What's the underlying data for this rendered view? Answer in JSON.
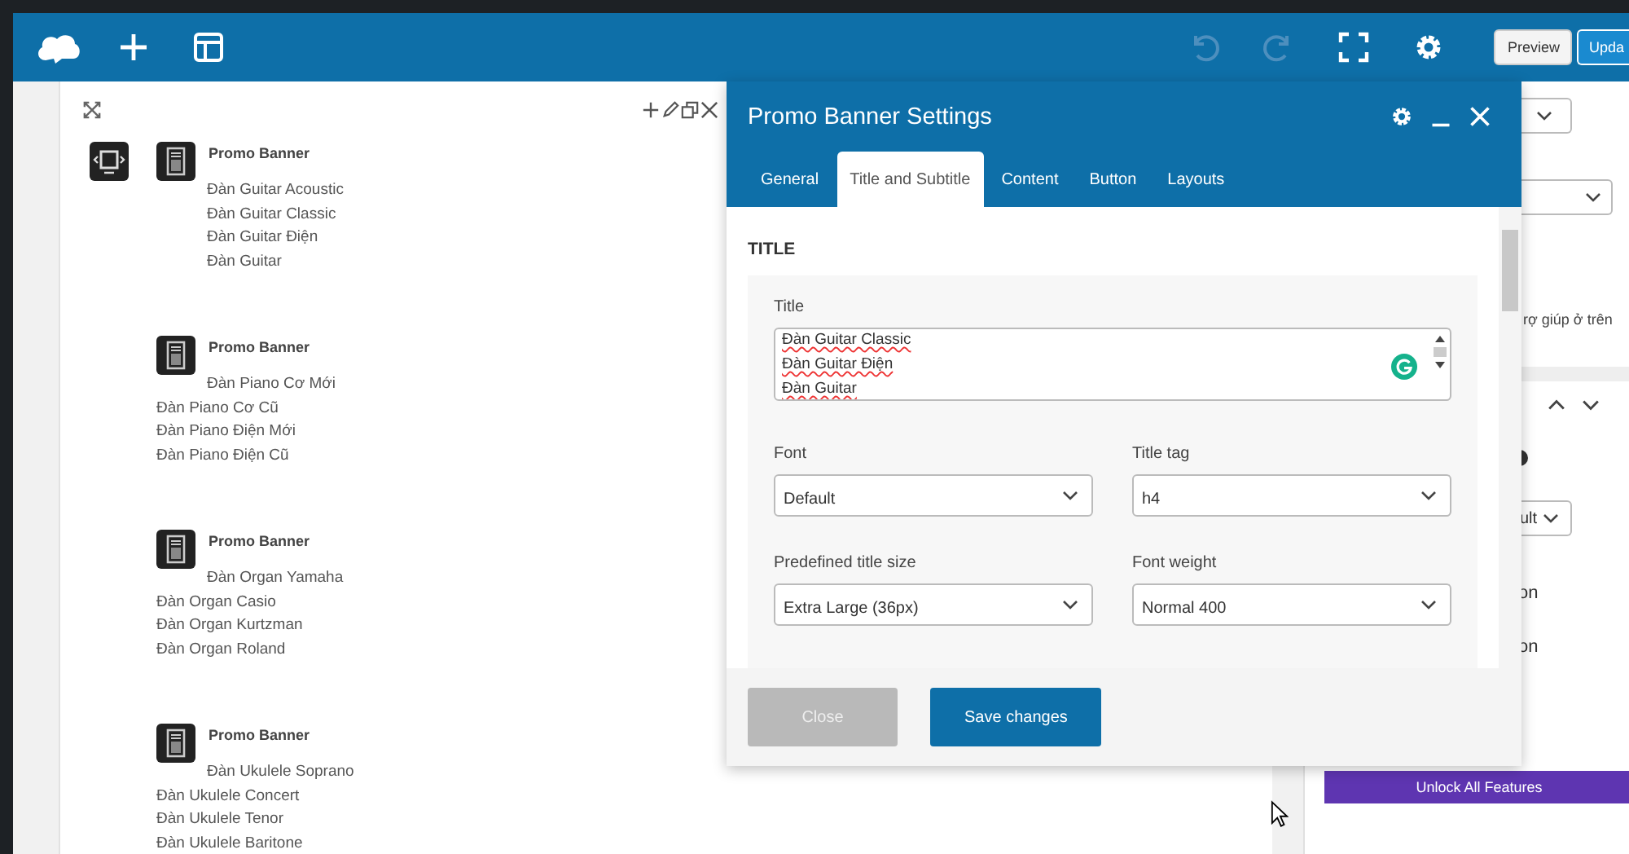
{
  "toolbar": {
    "preview": "Preview",
    "update": "Upda"
  },
  "banners": [
    {
      "title": "Promo Banner",
      "beside_icon": [
        "Đàn Guitar Acoustic",
        "Đàn Guitar Classic",
        "Đàn Guitar Điện",
        "Đàn Guitar"
      ]
    },
    {
      "title": "Promo Banner",
      "beside_icon": [
        "Đàn Piano Cơ Mới"
      ],
      "below": [
        "Đàn Piano Cơ Cũ",
        "Đàn Piano Điện Mới",
        "Đàn Piano Điện Cũ"
      ]
    },
    {
      "title": "Promo Banner",
      "beside_icon": [
        "Đàn Organ Yamaha"
      ],
      "below": [
        "Đàn Organ Casio",
        "Đàn Organ Kurtzman",
        "Đàn Organ Roland"
      ]
    },
    {
      "title": "Promo Banner",
      "beside_icon": [
        "Đàn Ukulele Soprano"
      ],
      "below": [
        "Đàn Ukulele Concert",
        "Đàn Ukulele Tenor",
        "Đàn Ukulele Baritone"
      ]
    }
  ],
  "dialog": {
    "title": "Promo Banner Settings",
    "tabs": [
      {
        "label": "General",
        "selected": false
      },
      {
        "label": "Title and Subtitle",
        "selected": true
      },
      {
        "label": "Content",
        "selected": false
      },
      {
        "label": "Button",
        "selected": false
      },
      {
        "label": "Layouts",
        "selected": false
      }
    ],
    "section": "TITLE",
    "title_field": {
      "label": "Title",
      "lines": [
        "Đàn Guitar Classic",
        "Đàn Guitar Điện",
        "Đàn Guitar"
      ]
    },
    "selects": [
      {
        "label": "Font",
        "value": "Default"
      },
      {
        "label": "Title tag",
        "value": "h4"
      },
      {
        "label": "Predefined title size",
        "value": "Extra Large (36px)"
      },
      {
        "label": "Font weight",
        "value": "Normal 400"
      }
    ],
    "buttons": [
      {
        "label": "Close",
        "disabled": true
      },
      {
        "label": "Save changes",
        "disabled": false
      }
    ]
  },
  "sidebar": {
    "help_text": "rợ giúp ở trên",
    "select_value": "ult",
    "texts": [
      "on",
      "on"
    ],
    "unlock": "Unlock All Features"
  }
}
